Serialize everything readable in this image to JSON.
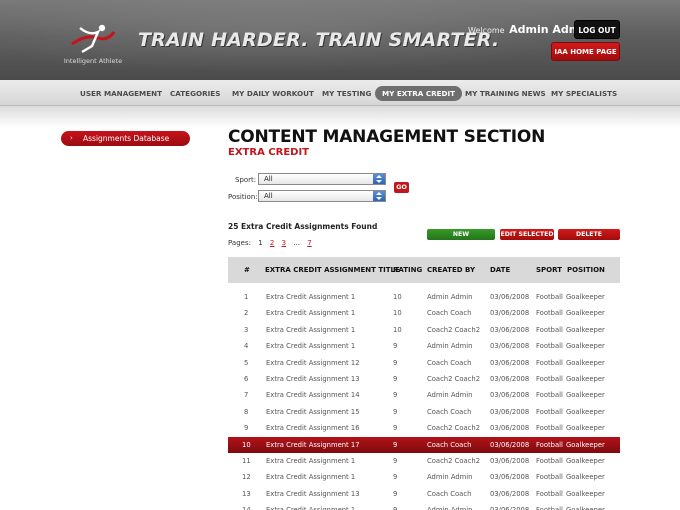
{
  "header": {
    "logo_text": "Intelligent Athlete",
    "slogan": "TRAIN HARDER. TRAIN SMARTER.",
    "welcome_label": "Welcome",
    "user_name": "Admin Admin",
    "logout_label": "LOG OUT",
    "home_label": "IAA HOME PAGE"
  },
  "nav": {
    "items": [
      {
        "label": "USER MANAGEMENT"
      },
      {
        "label": "CATEGORIES"
      },
      {
        "label": "MY DAILY WORKOUT"
      },
      {
        "label": "MY TESTING"
      },
      {
        "label": "MY EXTRA CREDIT",
        "active": true
      },
      {
        "label": "MY TRAINING NEWS"
      },
      {
        "label": "MY SPECIALISTS"
      }
    ]
  },
  "sidebar": {
    "items": [
      {
        "label": "Assignments Database"
      }
    ]
  },
  "content": {
    "title": "CONTENT MANAGEMENT SECTION",
    "subtitle": "EXTRA CREDIT",
    "filters": {
      "sport_label": "Sport:",
      "sport_value": "All",
      "position_label": "Position:",
      "position_value": "All",
      "go_label": "GO"
    },
    "found_text": "25 Extra Credit Assignments Found",
    "pages": {
      "label": "Pages:",
      "items": [
        "1",
        "2",
        "3",
        "...",
        "7"
      ]
    },
    "actions": {
      "new_label": "NEW ASSIGNMENTS",
      "edit_label": "EDIT SELECTED",
      "delete_label": "DELETE SELECTED"
    }
  },
  "table": {
    "columns": [
      "#",
      "EXTRA CREDIT ASSIGNMENT TITLE",
      "RATING",
      "CREATED BY",
      "DATE",
      "SPORT",
      "POSITION"
    ],
    "rows": [
      [
        "1",
        "Extra Credit Assignment 1",
        "10",
        "Admin Admin",
        "03/06/2008",
        "Football",
        "Goalkeeper"
      ],
      [
        "2",
        "Extra Credit Assignment 1",
        "10",
        "Coach Coach",
        "03/06/2008",
        "Football",
        "Goalkeeper"
      ],
      [
        "3",
        "Extra Credit Assignment 1",
        "10",
        "Coach2 Coach2",
        "03/06/2008",
        "Football",
        "Goalkeeper"
      ],
      [
        "4",
        "Extra Credit Assignment 1",
        "9",
        "Admin Admin",
        "03/06/2008",
        "Football",
        "Goalkeeper"
      ],
      [
        "5",
        "Extra Credit Assignment 12",
        "9",
        "Coach Coach",
        "03/06/2008",
        "Football",
        "Goalkeeper"
      ],
      [
        "6",
        "Extra Credit Assignment 13",
        "9",
        "Coach2 Coach2",
        "03/06/2008",
        "Football",
        "Goalkeeper"
      ],
      [
        "7",
        "Extra Credit Assignment 14",
        "9",
        "Admin Admin",
        "03/06/2008",
        "Football",
        "Goalkeeper"
      ],
      [
        "8",
        "Extra Credit Assignment 15",
        "9",
        "Coach Coach",
        "03/06/2008",
        "Football",
        "Goalkeeper"
      ],
      [
        "9",
        "Extra Credit Assignment 16",
        "9",
        "Coach2 Coach2",
        "03/06/2008",
        "Football",
        "Goalkeeper"
      ],
      [
        "10",
        "Extra Credit Assignment 17",
        "9",
        "Coach Coach",
        "03/06/2008",
        "Football",
        "Goalkeeper"
      ],
      [
        "11",
        "Extra Credit Assignment 1",
        "9",
        "Coach2 Coach2",
        "03/06/2008",
        "Football",
        "Goalkeeper"
      ],
      [
        "12",
        "Extra Credit Assignment 1",
        "9",
        "Admin Admin",
        "03/06/2008",
        "Football",
        "Goalkeeper"
      ],
      [
        "13",
        "Extra Credit Assignment 13",
        "9",
        "Coach Coach",
        "03/06/2008",
        "Football",
        "Goalkeeper"
      ],
      [
        "14",
        "Extra Credit Assignment 1",
        "9",
        "Admin Admin",
        "03/06/2008",
        "Football",
        "Goalkeeper"
      ]
    ],
    "selected_row": 9
  },
  "colors": {
    "accent_red": "#c0161d",
    "selected_row": "#9c0b10",
    "new_button": "#2e8a22",
    "header_gray": "#5e5e5e"
  }
}
